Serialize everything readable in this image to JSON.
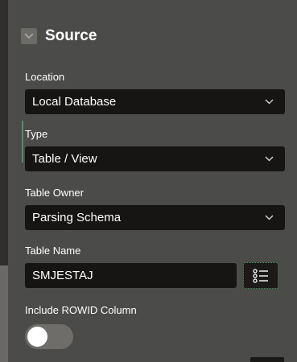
{
  "section": {
    "title": "Source",
    "collapse_icon": "chevron-down-icon"
  },
  "fields": {
    "location": {
      "label": "Location",
      "value": "Local Database"
    },
    "type": {
      "label": "Type",
      "value": "Table / View"
    },
    "table_owner": {
      "label": "Table Owner",
      "value": "Parsing Schema"
    },
    "table_name": {
      "label": "Table Name",
      "value": "SMJESTAJ",
      "lov_icon": "list-icon"
    },
    "include_rowid": {
      "label": "Include ROWID Column",
      "enabled": false
    }
  },
  "colors": {
    "panel_background": "#4b4b49",
    "field_background": "#161513",
    "active_marker": "#5c8a6c",
    "focus_ring": "#54a063",
    "toggle_off": "#6e6d6a"
  }
}
